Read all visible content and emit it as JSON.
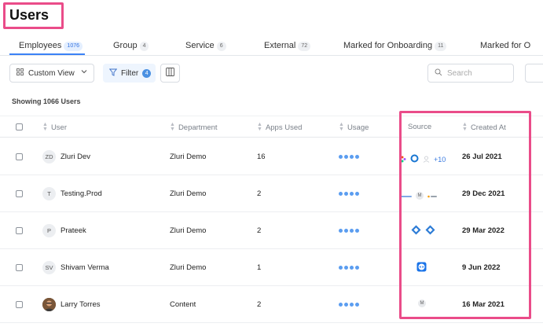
{
  "page": {
    "title": "Users"
  },
  "tabs": [
    {
      "label": "Employees",
      "count": "1076"
    },
    {
      "label": "Group",
      "count": "4"
    },
    {
      "label": "Service",
      "count": "6"
    },
    {
      "label": "External",
      "count": "72"
    },
    {
      "label": "Marked for Onboarding",
      "count": "11"
    },
    {
      "label": "Marked for O",
      "count": ""
    }
  ],
  "toolbar": {
    "custom_view_label": "Custom View",
    "filter_label": "Filter",
    "filter_count": "4",
    "search_placeholder": "Search"
  },
  "table": {
    "showing_text": "Showing 1066 Users",
    "headers": {
      "user": "User",
      "department": "Department",
      "apps_used": "Apps Used",
      "usage": "Usage",
      "source": "Source",
      "created_at": "Created At"
    },
    "rows": [
      {
        "initials": "ZD",
        "name": "Zluri Dev",
        "department": "Zluri Demo",
        "apps_used": "16",
        "source_extra": "+10",
        "created_at": "26 Jul 2021"
      },
      {
        "initials": "T",
        "name": "Testing.Prod",
        "department": "Zluri Demo",
        "apps_used": "2",
        "source_extra": "M",
        "created_at": "29 Dec 2021"
      },
      {
        "initials": "P",
        "name": "Prateek",
        "department": "Zluri Demo",
        "apps_used": "2",
        "source_extra": "",
        "created_at": "29 Mar 2022"
      },
      {
        "initials": "SV",
        "name": "Shivam Verma",
        "department": "Zluri Demo",
        "apps_used": "1",
        "source_extra": "",
        "created_at": "9 Jun 2022"
      },
      {
        "initials": "",
        "name": "Larry Torres",
        "department": "Content",
        "apps_used": "2",
        "source_extra": "M",
        "created_at": "16 Mar 2021"
      }
    ]
  },
  "colors": {
    "accent": "#3b82f6",
    "highlight": "#ea4c89",
    "usage_dot": "#5b9df0"
  }
}
